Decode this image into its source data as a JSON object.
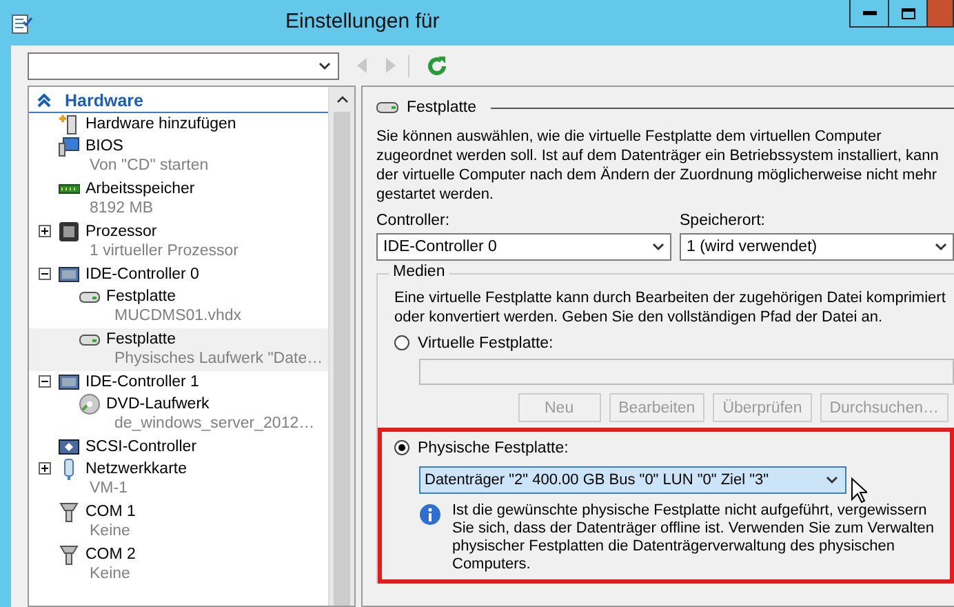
{
  "window": {
    "title": "Einstellungen für"
  },
  "tree": {
    "header": "Hardware",
    "items": [
      {
        "name": "Hardware hinzufügen",
        "selected": false
      },
      {
        "name": "BIOS",
        "detail": "Von \"CD\" starten",
        "selected": false
      },
      {
        "name": "Arbeitsspeicher",
        "detail": "8192 MB",
        "selected": false
      },
      {
        "name": "Prozessor",
        "detail": "1 virtueller Prozessor",
        "expanded": false,
        "selected": false
      },
      {
        "name": "IDE-Controller 0",
        "expanded": true,
        "selected": false,
        "children": [
          {
            "name": "Festplatte",
            "detail": "MUCDMS01.vhdx",
            "selected": false
          },
          {
            "name": "Festplatte",
            "detail": "Physisches Laufwerk \"Date…",
            "selected": true
          }
        ]
      },
      {
        "name": "IDE-Controller 1",
        "expanded": true,
        "selected": false,
        "children": [
          {
            "name": "DVD-Laufwerk",
            "detail": "de_windows_server_2012…",
            "selected": false
          }
        ]
      },
      {
        "name": "SCSI-Controller",
        "selected": false
      },
      {
        "name": "Netzwerkkarte",
        "detail": "VM-1",
        "expanded": false,
        "selected": false
      },
      {
        "name": "COM 1",
        "detail": "Keine",
        "selected": false
      },
      {
        "name": "COM 2",
        "detail": "Keine",
        "selected": false
      }
    ]
  },
  "section": {
    "title": "Festplatte",
    "description": "Sie können auswählen, wie die virtuelle Festplatte dem virtuellen Computer zugeordnet werden soll. Ist auf dem Datenträger ein Betriebssystem installiert, kann der virtuelle Computer nach dem Ändern der Zuordnung möglicherweise nicht mehr gestartet werden.",
    "controller": {
      "label": "Controller:",
      "value": "IDE-Controller 0"
    },
    "location": {
      "label": "Speicherort:",
      "value": "1 (wird verwendet)"
    },
    "media": {
      "title": "Medien",
      "description": "Eine virtuelle Festplatte kann durch Bearbeiten der zugehörigen Datei komprimiert oder konvertiert werden. Geben Sie den vollständigen Pfad der Datei an.",
      "virtual": {
        "label": "Virtuelle Festplatte:",
        "selected": false
      },
      "buttons": [
        {
          "label": "Neu",
          "disabled": true
        },
        {
          "label": "Bearbeiten",
          "disabled": true
        },
        {
          "label": "Überprüfen",
          "disabled": true
        },
        {
          "label": "Durchsuchen…",
          "disabled": true
        }
      ],
      "physical": {
        "label": "Physische Festplatte:",
        "selected": true,
        "value": "Datenträger \"2\" 400.00 GB Bus \"0\" LUN \"0\" Ziel \"3\""
      },
      "info": "Ist die gewünschte physische Festplatte nicht aufgeführt, vergewissern Sie sich, dass der Datenträger offline ist. Verwenden Sie zum Verwalten physischer Festplatten die Datenträgerverwaltung des physischen Computers."
    }
  }
}
